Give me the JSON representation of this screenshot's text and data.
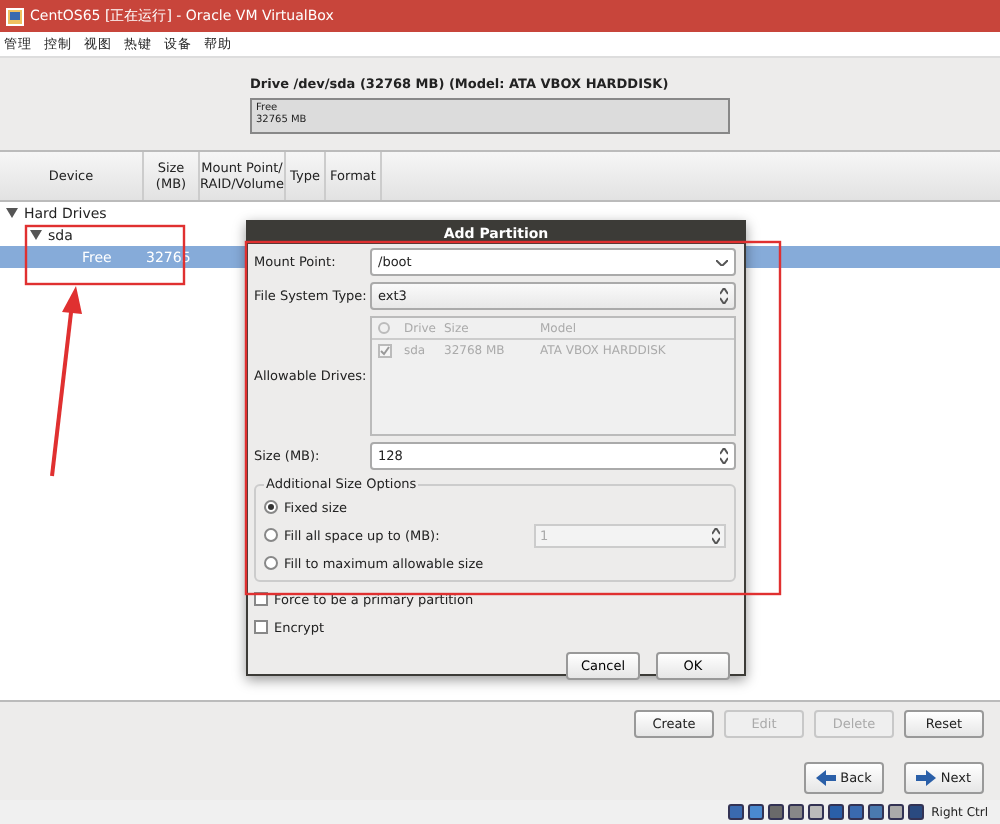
{
  "window": {
    "title": "CentOS65 [正在运行] - Oracle VM VirtualBox"
  },
  "menu": [
    "管理",
    "控制",
    "视图",
    "热键",
    "设备",
    "帮助"
  ],
  "drive": {
    "title": "Drive /dev/sda (32768 MB) (Model: ATA VBOX HARDDISK)",
    "segment_label": "Free",
    "segment_size": "32765 MB"
  },
  "device_table": {
    "columns": [
      "Device",
      "Size (MB)",
      "Mount Point/ RAID/Volume",
      "Type",
      "Format"
    ],
    "tree": [
      {
        "label": "Hard Drives",
        "selected": false,
        "expanded": true,
        "children": [
          {
            "label": "sda",
            "selected": false,
            "expanded": true,
            "children": [
              {
                "label": "Free",
                "size": "32765",
                "selected": true
              }
            ]
          }
        ]
      }
    ]
  },
  "dialog": {
    "title": "Add Partition",
    "mount_point": {
      "label": "Mount Point:",
      "value": "/boot"
    },
    "fs_type": {
      "label": "File System Type:",
      "value": "ext3"
    },
    "allowable_drives": {
      "label": "Allowable Drives:",
      "columns": [
        "Drive",
        "Size",
        "Model"
      ],
      "rows": [
        {
          "checked": true,
          "drive": "sda",
          "size": "32768 MB",
          "model": "ATA VBOX HARDDISK"
        }
      ]
    },
    "size": {
      "label": "Size (MB):",
      "value": "128"
    },
    "size_options": {
      "title": "Additional Size Options",
      "options": [
        {
          "label": "Fixed size",
          "selected": true
        },
        {
          "label": "Fill all space up to (MB):",
          "selected": false,
          "value": "1"
        },
        {
          "label": "Fill to maximum allowable size",
          "selected": false
        }
      ]
    },
    "checkboxes": [
      {
        "label": "Force to be a primary partition",
        "checked": false
      },
      {
        "label": "Encrypt",
        "checked": false
      }
    ],
    "buttons": [
      "Cancel",
      "OK"
    ]
  },
  "actions": [
    {
      "label": "Create",
      "disabled": false
    },
    {
      "label": "Edit",
      "disabled": true
    },
    {
      "label": "Delete",
      "disabled": true
    },
    {
      "label": "Reset",
      "disabled": false
    }
  ],
  "navigation": [
    "Back",
    "Next"
  ],
  "status_bar": {
    "host_key": "Right Ctrl"
  },
  "annotations": [
    {
      "kind": "box"
    },
    {
      "kind": "box"
    },
    {
      "kind": "arrow"
    }
  ]
}
